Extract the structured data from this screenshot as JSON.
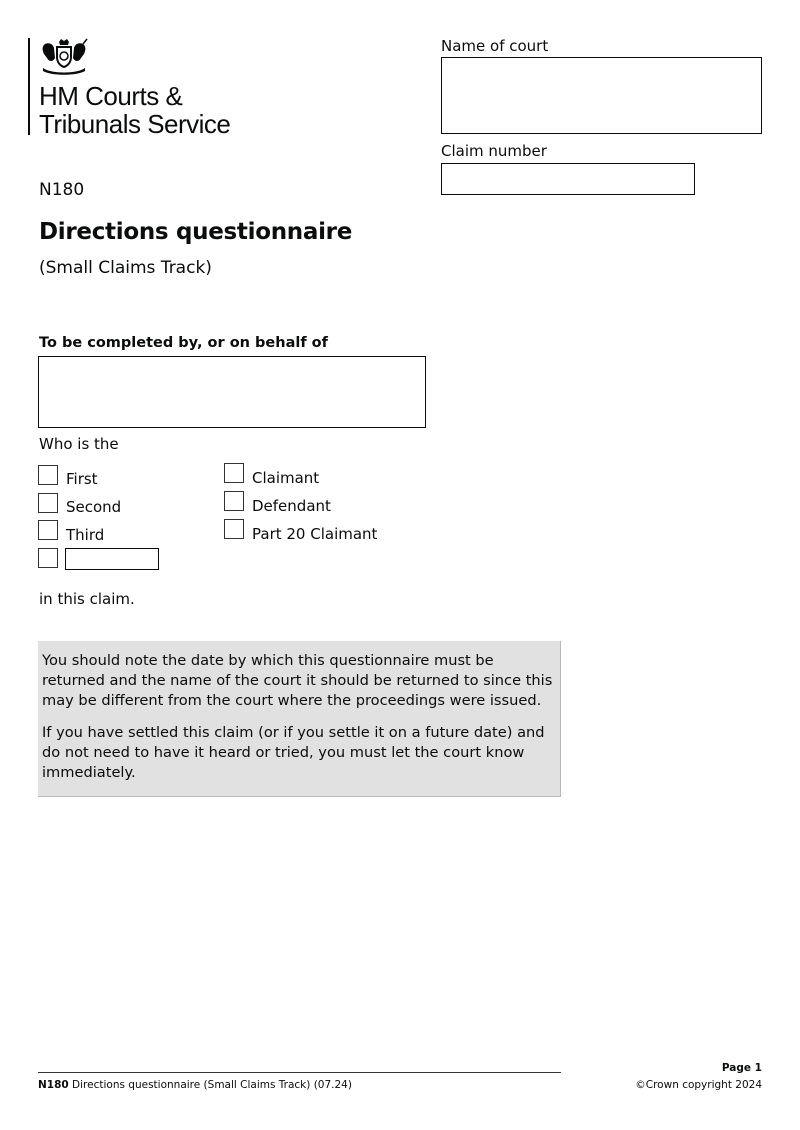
{
  "header": {
    "organisation_line1": "HM Courts &",
    "organisation_line2": "Tribunals Service",
    "crest_icon": "royal-coat-of-arms-icon",
    "name_of_court": {
      "label": "Name of court",
      "value": ""
    },
    "claim_number": {
      "label": "Claim number",
      "value": ""
    }
  },
  "form": {
    "code": "N180",
    "title": "Directions questionnaire",
    "subtitle": "(Small Claims Track)",
    "completed_by": {
      "label": "To be completed by, or on behalf of",
      "value": ""
    },
    "who_is_the_label": "Who is the",
    "position_options": [
      {
        "label": "First",
        "checked": false
      },
      {
        "label": "Second",
        "checked": false
      },
      {
        "label": "Third",
        "checked": false
      },
      {
        "label": "",
        "checked": false,
        "other_value": ""
      }
    ],
    "role_options": [
      {
        "label": "Claimant",
        "checked": false
      },
      {
        "label": "Defendant",
        "checked": false
      },
      {
        "label": "Part 20 Claimant",
        "checked": false
      }
    ],
    "in_this_claim": "in this claim."
  },
  "notice": {
    "paragraphs": [
      "You should note the date by which this questionnaire must be returned and the name of the court it should be returned to since this may be different from the court where the proceedings were issued.",
      "If you have settled this claim (or if you settle it on a future date) and do not need to have it heard or tried, you must let the court know immediately."
    ],
    "background_color": "#e1e1e1"
  },
  "footer": {
    "form_code": "N180",
    "form_description": " Directions questionnaire (Small Claims Track) (07.24)",
    "page": "Page 1",
    "copyright": "©Crown copyright 2024"
  }
}
